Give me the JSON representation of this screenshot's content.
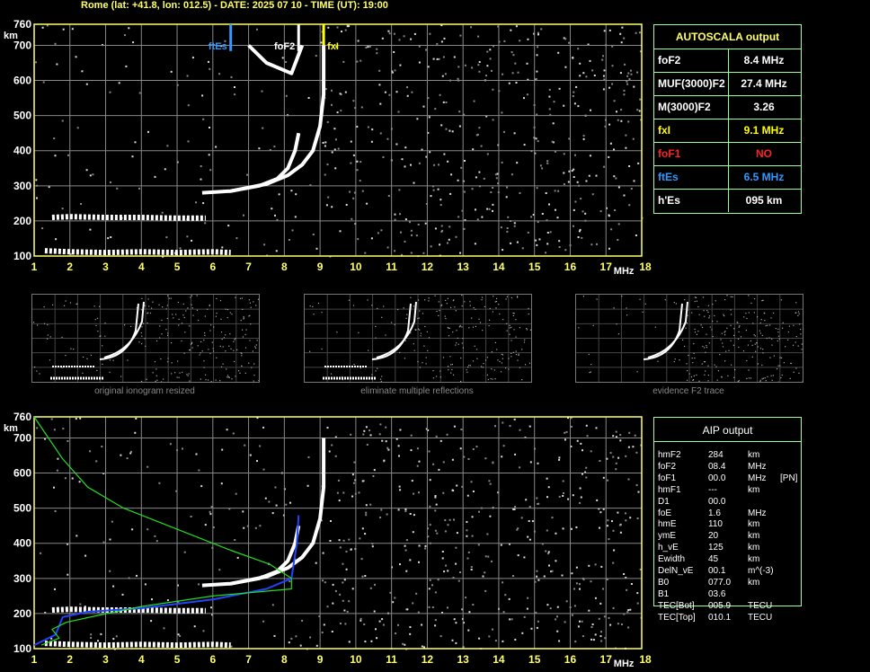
{
  "header": "Rome (lat: +41.8, lon: 012.5) - DATE: 2025 07 10 - TIME (UT): 19:00",
  "colors": {
    "axis": "#ffff66",
    "grid": "#888888",
    "trace_white": "#ffffff",
    "green_profile": "#22dd22",
    "blue_trace": "#2244ff",
    "box_border": "#99ff99"
  },
  "chart_data": [
    {
      "type": "scatter",
      "xlabel": "MHz",
      "ylabel": "km",
      "xlim": [
        1,
        18
      ],
      "ylim": [
        100,
        760
      ],
      "x_ticks": [
        "1",
        "2",
        "3",
        "4",
        "5",
        "6",
        "7",
        "8",
        "9",
        "10",
        "11",
        "12",
        "13",
        "14",
        "15",
        "16",
        "17",
        "18"
      ],
      "y_ticks": [
        "100",
        "200",
        "300",
        "400",
        "500",
        "600",
        "700",
        "760"
      ],
      "markers": [
        {
          "label": "ftEs",
          "x": 6.5,
          "color": "#3399ff"
        },
        {
          "label": "foF2",
          "x": 8.4,
          "color": "#ffffff"
        },
        {
          "label": "fxI",
          "x": 9.1,
          "color": "#ffff00"
        }
      ],
      "series": [
        {
          "points": [
            [
              1.3,
              115
            ],
            [
              2,
              112
            ],
            [
              3,
              110
            ],
            [
              4,
              112
            ],
            [
              5,
              110
            ],
            [
              6,
              112
            ],
            [
              6.5,
              110
            ]
          ]
        },
        {
          "points": [
            [
              1.5,
              210
            ],
            [
              2,
              212
            ],
            [
              3,
              210
            ],
            [
              4,
              210
            ],
            [
              5,
              208
            ],
            [
              5.8,
              208
            ]
          ]
        },
        {
          "points": [
            [
              5.7,
              280
            ],
            [
              6.5,
              285
            ],
            [
              7.3,
              300
            ],
            [
              7.8,
              320
            ],
            [
              8.1,
              350
            ],
            [
              8.3,
              400
            ],
            [
              8.4,
              450
            ]
          ]
        },
        {
          "points": [
            [
              6.5,
              285
            ],
            [
              7.5,
              305
            ],
            [
              8.1,
              330
            ],
            [
              8.5,
              360
            ],
            [
              8.8,
              400
            ],
            [
              9.0,
              470
            ],
            [
              9.1,
              560
            ],
            [
              9.1,
              700
            ]
          ]
        },
        {
          "points": [
            [
              7.0,
              700
            ],
            [
              7.5,
              650
            ],
            [
              8.2,
              620
            ],
            [
              8.5,
              700
            ]
          ]
        }
      ]
    },
    {
      "type": "line",
      "xlabel": "MHz",
      "ylabel": "km",
      "xlim": [
        1,
        18
      ],
      "ylim": [
        100,
        760
      ],
      "x_ticks": [
        "1",
        "2",
        "3",
        "4",
        "5",
        "6",
        "7",
        "8",
        "9",
        "10",
        "11",
        "12",
        "13",
        "14",
        "15",
        "16",
        "17",
        "18"
      ],
      "y_ticks": [
        "100",
        "200",
        "300",
        "400",
        "500",
        "600",
        "700",
        "760"
      ],
      "series": [
        {
          "points": [
            [
              1.3,
              115
            ],
            [
              2,
              112
            ],
            [
              3,
              110
            ],
            [
              4,
              112
            ],
            [
              5,
              110
            ],
            [
              6,
              112
            ],
            [
              6.5,
              110
            ]
          ]
        },
        {
          "points": [
            [
              1.5,
              210
            ],
            [
              2,
              212
            ],
            [
              3,
              210
            ],
            [
              4,
              210
            ],
            [
              5,
              208
            ],
            [
              5.8,
              208
            ]
          ]
        },
        {
          "points": [
            [
              5.7,
              280
            ],
            [
              6.5,
              285
            ],
            [
              7.3,
              300
            ],
            [
              7.8,
              320
            ],
            [
              8.1,
              350
            ],
            [
              8.3,
              400
            ],
            [
              8.4,
              450
            ]
          ]
        },
        {
          "points": [
            [
              6.5,
              285
            ],
            [
              7.5,
              305
            ],
            [
              8.1,
              330
            ],
            [
              8.5,
              360
            ],
            [
              8.8,
              400
            ],
            [
              9.0,
              470
            ],
            [
              9.1,
              560
            ],
            [
              9.1,
              700
            ]
          ]
        },
        {
          "points": [
            [
              1,
              110
            ],
            [
              1.6,
              140
            ],
            [
              1.8,
              190
            ],
            [
              2.5,
              205
            ],
            [
              4,
              215
            ],
            [
              6,
              240
            ],
            [
              7.5,
              270
            ],
            [
              8.2,
              300
            ],
            [
              8.35,
              400
            ],
            [
              8.4,
              480
            ]
          ]
        },
        {
          "points": [
            [
              1,
              760
            ],
            [
              1.4,
              700
            ],
            [
              1.8,
              640
            ],
            [
              2.5,
              560
            ],
            [
              3.5,
              500
            ],
            [
              5,
              440
            ],
            [
              6.5,
              380
            ],
            [
              7.6,
              340
            ],
            [
              8.2,
              300
            ],
            [
              8.2,
              270
            ],
            [
              6,
              250
            ],
            [
              4,
              220
            ],
            [
              2.8,
              195
            ],
            [
              1.9,
              175
            ],
            [
              1.5,
              155
            ],
            [
              1.7,
              130
            ],
            [
              1.2,
              110
            ]
          ]
        }
      ]
    }
  ],
  "thumbnails": [
    {
      "caption": "original ionogram resized"
    },
    {
      "caption": "eliminate multiple reflections"
    },
    {
      "caption": "evidence F2 trace"
    }
  ],
  "autoscala": {
    "title": "AUTOSCALA output",
    "rows": [
      {
        "key": "foF2",
        "value": "8.4 MHz",
        "color": "#ffffff"
      },
      {
        "key": "MUF(3000)F2",
        "value": "27.4 MHz",
        "color": "#ffffff"
      },
      {
        "key": "M(3000)F2",
        "value": "3.26",
        "color": "#ffffff"
      },
      {
        "key": "fxI",
        "value": "9.1 MHz",
        "color": "#ffff00"
      },
      {
        "key": "foF1",
        "value": "NO",
        "color": "#ff2222"
      },
      {
        "key": "ftEs",
        "value": "6.5 MHz",
        "color": "#3399ff"
      },
      {
        "key": "h'Es",
        "value": "095    km",
        "color": "#ffffff"
      }
    ]
  },
  "aip": {
    "title": "AIP output",
    "rows": [
      {
        "k": "hmF2",
        "v": "284",
        "u": "km",
        "x": ""
      },
      {
        "k": "foF2",
        "v": "08.4",
        "u": "MHz",
        "x": ""
      },
      {
        "k": "foF1",
        "v": "00.0",
        "u": "MHz",
        "x": "[PN]"
      },
      {
        "k": "hmF1",
        "v": "---",
        "u": "km",
        "x": ""
      },
      {
        "k": "D1",
        "v": "00.0",
        "u": "",
        "x": ""
      },
      {
        "k": "foE",
        "v": "1.6",
        "u": "MHz",
        "x": ""
      },
      {
        "k": "hmE",
        "v": "110",
        "u": "km",
        "x": ""
      },
      {
        "k": "ymE",
        "v": "20",
        "u": "km",
        "x": ""
      },
      {
        "k": "h_vE",
        "v": "125",
        "u": "km",
        "x": ""
      },
      {
        "k": "Ewidth",
        "v": "45",
        "u": "km",
        "x": ""
      },
      {
        "k": "DelN_vE",
        "v": "00.1",
        "u": "m^(-3)",
        "x": ""
      },
      {
        "k": "B0",
        "v": "077.0",
        "u": "km",
        "x": ""
      },
      {
        "k": "B1",
        "v": "03.6",
        "u": "",
        "x": ""
      },
      {
        "k": "TEC[Bot]",
        "v": "005.9",
        "u": "TECU",
        "x": ""
      },
      {
        "k": "TEC[Top]",
        "v": "010.1",
        "u": "TECU",
        "x": ""
      }
    ]
  }
}
